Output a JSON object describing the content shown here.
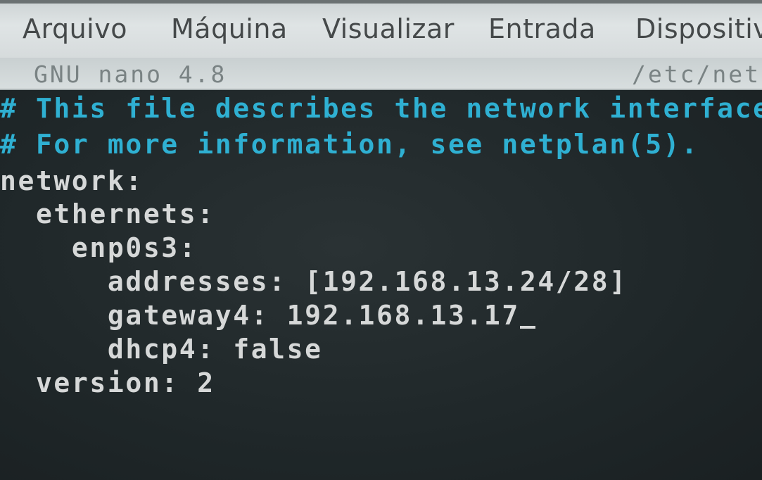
{
  "menubar": {
    "items": [
      {
        "label": "Arquivo"
      },
      {
        "label": "Máquina"
      },
      {
        "label": "Visualizar"
      },
      {
        "label": "Entrada"
      },
      {
        "label": "Dispositiv"
      }
    ]
  },
  "nano": {
    "version": "GNU nano 4.8",
    "filepath": "/etc/net"
  },
  "editor": {
    "lines": [
      {
        "text": "# This file describes the network interfaces a",
        "type": "comment"
      },
      {
        "text": "# For more information, see netplan(5).",
        "type": "comment"
      },
      {
        "text": "network:",
        "type": "code"
      },
      {
        "text": "  ethernets:",
        "type": "code"
      },
      {
        "text": "    enp0s3:",
        "type": "code"
      },
      {
        "text": "      addresses: [192.168.13.24/28]",
        "type": "code"
      },
      {
        "text": "      gateway4: 192.168.13.17",
        "type": "code"
      },
      {
        "text": "      dhcp4: false",
        "type": "code"
      },
      {
        "text": "  version: 2",
        "type": "code"
      }
    ]
  },
  "colors": {
    "comment": "#2fb0d2",
    "code": "#d6d8d8",
    "background": "#1f2628",
    "menubar": "#dfe4e5"
  }
}
